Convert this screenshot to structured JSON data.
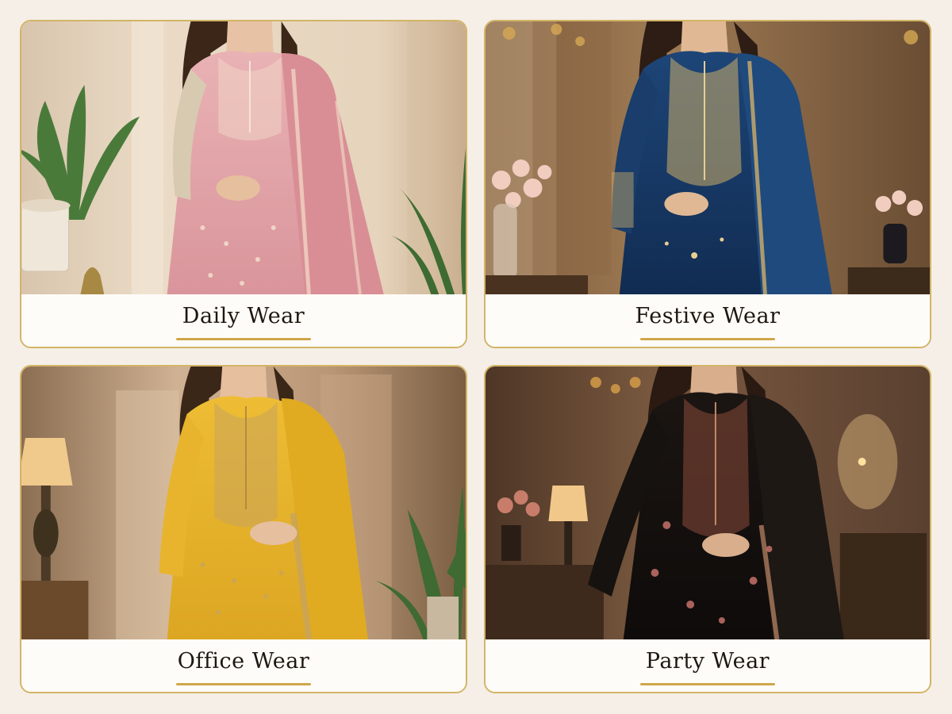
{
  "categories": [
    {
      "label": "Daily Wear",
      "outfit_color": "#e2a3a8",
      "dupatta_color": "#d98e95",
      "embroidery_color": "#f3dcc7",
      "backdrop_color": "#eadbc6"
    },
    {
      "label": "Festive Wear",
      "outfit_color": "#173a66",
      "dupatta_color": "#1f4a7d",
      "embroidery_color": "#cfae6a",
      "backdrop_color": "#8a6a45"
    },
    {
      "label": "Office Wear",
      "outfit_color": "#e6b52a",
      "dupatta_color": "#e0ab21",
      "embroidery_color": "#c8a45c",
      "backdrop_color": "#c5a07a"
    },
    {
      "label": "Party Wear",
      "outfit_color": "#15110f",
      "dupatta_color": "#1e1815",
      "embroidery_color": "#c08a6a",
      "backdrop_color": "#5a4030"
    }
  ],
  "accent": {
    "border": "#d3b466",
    "underline": "#d0a64a",
    "caption_bg": "#fefcf8",
    "page_bg": "#f5efe8"
  }
}
